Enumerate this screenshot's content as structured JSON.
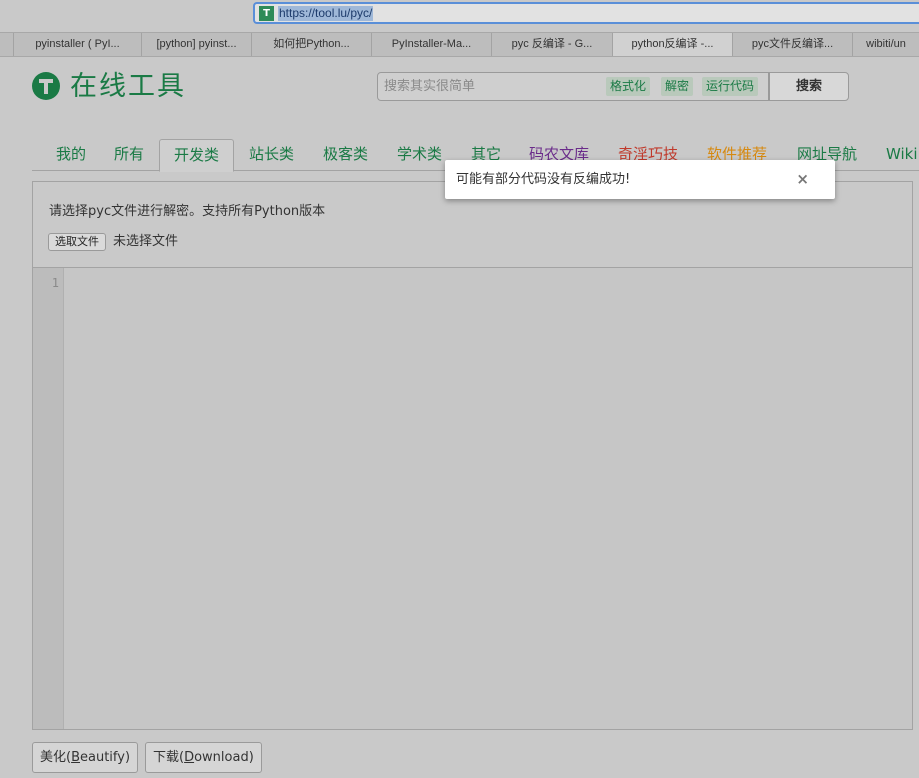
{
  "browser": {
    "url": "https://tool.lu/pyc/",
    "favicon_icon": "tool-lu-favicon",
    "tabs": [
      {
        "label": "pyinstaller ( PyI..."
      },
      {
        "label": "[python] pyinst..."
      },
      {
        "label": "如何把Python..."
      },
      {
        "label": "PyInstaller-Ma..."
      },
      {
        "label": "pyc 反编译 - G..."
      },
      {
        "label": "python反编译 -..."
      },
      {
        "label": "pyc文件反编译..."
      },
      {
        "label": "wibiti/un"
      }
    ]
  },
  "header": {
    "logo_icon": "tool-logo-icon",
    "logo_text": "在线工具",
    "search": {
      "placeholder": "搜索其实很简单",
      "quick_links": [
        "格式化",
        "解密",
        "运行代码"
      ],
      "button_label": "搜索"
    }
  },
  "nav": {
    "items": [
      {
        "label": "我的",
        "color": "#1a7a45"
      },
      {
        "label": "所有",
        "color": "#1a7a45"
      },
      {
        "label": "开发类",
        "color": "#1a7a45"
      },
      {
        "label": "站长类",
        "color": "#1a7a45"
      },
      {
        "label": "极客类",
        "color": "#1a7a45"
      },
      {
        "label": "学术类",
        "color": "#1a7a45"
      },
      {
        "label": "其它",
        "color": "#1a7a45"
      },
      {
        "label": "码农文库",
        "color": "#6a2b8a"
      },
      {
        "label": "奇淫巧技",
        "color": "#c0392b"
      },
      {
        "label": "软件推荐",
        "color": "#d68910"
      },
      {
        "label": "网址导航",
        "color": "#1a7a45"
      },
      {
        "label": "Wiki",
        "color": "#1a7a45"
      }
    ],
    "active_index": 2
  },
  "tool": {
    "instruction": "请选择pyc文件进行解密。支持所有Python版本",
    "file_button": "选取文件",
    "file_status": "未选择文件",
    "line_number": "1",
    "buttons": [
      {
        "pre": "美化(",
        "key": "B",
        "post": "eautify)"
      },
      {
        "pre": "下载(",
        "key": "D",
        "post": "ownload)"
      }
    ]
  },
  "alert": {
    "message": "可能有部分代码没有反编成功!",
    "close_symbol": "×"
  }
}
